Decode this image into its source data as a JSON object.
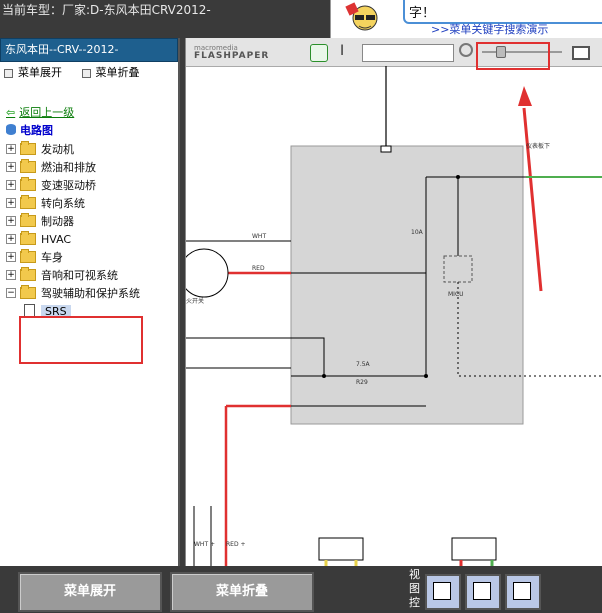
{
  "window": {
    "title": "当前车型：厂家:D-东风本田CRV2012-"
  },
  "banner": {
    "line1": "字！",
    "line2": ">>菜单关键字搜索演示"
  },
  "sidebar": {
    "header": "东风本田--CRV--2012-",
    "expand_label": "菜单展开",
    "collapse_label": "菜单折叠",
    "back_label": "返回上一级",
    "root_label": "电路图",
    "items": [
      {
        "label": "发动机"
      },
      {
        "label": "燃油和排放"
      },
      {
        "label": "变速驱动桥"
      },
      {
        "label": "转向系统"
      },
      {
        "label": "制动器"
      },
      {
        "label": "HVAC"
      },
      {
        "label": "车身"
      },
      {
        "label": "音响和可视系统"
      },
      {
        "label": "驾驶辅助和保护系统"
      }
    ],
    "child_label": "SRS"
  },
  "viewer": {
    "logo_top": "macromedia",
    "logo_bottom": "FLASHPAPER"
  },
  "diagram": {
    "labels": {
      "top_right": "仪表板下",
      "fuse_label": "7.5A",
      "relay_label": "MICU",
      "fuse_r29": "R29",
      "fuse_10": "10A",
      "w1": "WHT",
      "w2": "RED",
      "w3": "WHT +",
      "w4": "RED +",
      "ig": "点火开关"
    }
  },
  "bottom_bar": {
    "expand_button": "菜单展开",
    "collapse_button": "菜单折叠",
    "view_label": "视图控"
  },
  "colors": {
    "accent": "#e03030",
    "header_blue": "#1e5f8e"
  }
}
